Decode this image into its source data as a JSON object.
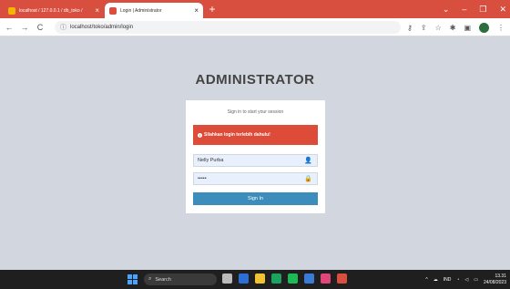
{
  "browser": {
    "tabs": [
      {
        "label": "localhost / 127.0.0.1 / db_toko /",
        "active": false
      },
      {
        "label": "Login | Administrator",
        "active": true
      }
    ],
    "url": "localhost/toko/admin/login",
    "new_tab_symbol": "+",
    "tab_close_symbol": "×"
  },
  "page": {
    "title": "ADMINISTRATOR",
    "login_message": "Sign in to start your session",
    "alert_text": "Silahkan login terlebih dahulu!",
    "username_value": "Nelly Purba",
    "password_value": "•••••",
    "signin_label": "Sign In"
  },
  "taskbar": {
    "search_placeholder": "Search",
    "language": "IND",
    "time": "13.31",
    "date": "24/08/2023"
  },
  "colors": {
    "chrome_accent": "#d94f3f",
    "alert_red": "#dd4b39",
    "button_blue": "#3c8dbc",
    "page_bg": "#d2d6de"
  }
}
